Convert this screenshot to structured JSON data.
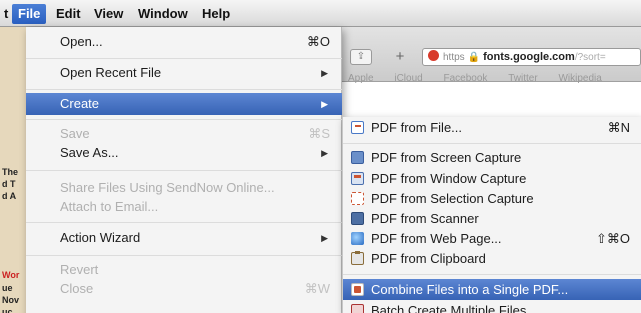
{
  "menubar": {
    "items": [
      {
        "label": "t"
      },
      {
        "label": "File"
      },
      {
        "label": "Edit"
      },
      {
        "label": "View"
      },
      {
        "label": "Window"
      },
      {
        "label": "Help"
      }
    ],
    "active_item": "File"
  },
  "browser": {
    "address": {
      "protocol": "https",
      "host": "fonts.google.com",
      "path": "/?sort="
    },
    "bookmarks": [
      "Apple",
      "iCloud",
      "Facebook",
      "Twitter",
      "Wikipedia"
    ]
  },
  "left_page": {
    "lines": [
      "The",
      "d T",
      "d A",
      "Wor",
      "ue",
      "Nov",
      "uc"
    ]
  },
  "file_menu": {
    "items": [
      {
        "label": "Open...",
        "shortcut": "⌘O",
        "enabled": true
      },
      {
        "label": "Open Recent File",
        "submenu": true,
        "enabled": true
      },
      {
        "label": "Create",
        "submenu": true,
        "enabled": true,
        "highlighted": true
      },
      {
        "label": "Save",
        "shortcut": "⌘S",
        "enabled": false
      },
      {
        "label": "Save As...",
        "submenu": true,
        "enabled": true
      },
      {
        "label": "Share Files Using SendNow Online...",
        "enabled": false
      },
      {
        "label": "Attach to Email...",
        "enabled": false
      },
      {
        "label": "Action Wizard",
        "submenu": true,
        "enabled": true
      },
      {
        "label": "Revert",
        "enabled": false
      },
      {
        "label": "Close",
        "shortcut": "⌘W",
        "enabled": false
      }
    ]
  },
  "create_submenu": {
    "items": [
      {
        "label": "PDF from File...",
        "shortcut": "⌘N",
        "icon": "pdf-file-icon"
      },
      {
        "label": "PDF from Screen Capture",
        "icon": "screen-capture-icon"
      },
      {
        "label": "PDF from Window Capture",
        "icon": "window-capture-icon"
      },
      {
        "label": "PDF from Selection Capture",
        "icon": "selection-capture-icon"
      },
      {
        "label": "PDF from Scanner",
        "icon": "scanner-icon"
      },
      {
        "label": "PDF from Web Page...",
        "shortcut": "⇧⌘O",
        "icon": "web-page-icon"
      },
      {
        "label": "PDF from Clipboard",
        "icon": "clipboard-icon"
      },
      {
        "label": "Combine Files into a Single PDF...",
        "icon": "combine-files-icon",
        "highlighted": true
      },
      {
        "label": "Batch Create Multiple Files...",
        "icon": "batch-create-icon"
      }
    ]
  },
  "colors": {
    "highlight": "#3763b5",
    "menu_bg": "#f4f4f4",
    "disabled_text": "#b0b0b0"
  }
}
